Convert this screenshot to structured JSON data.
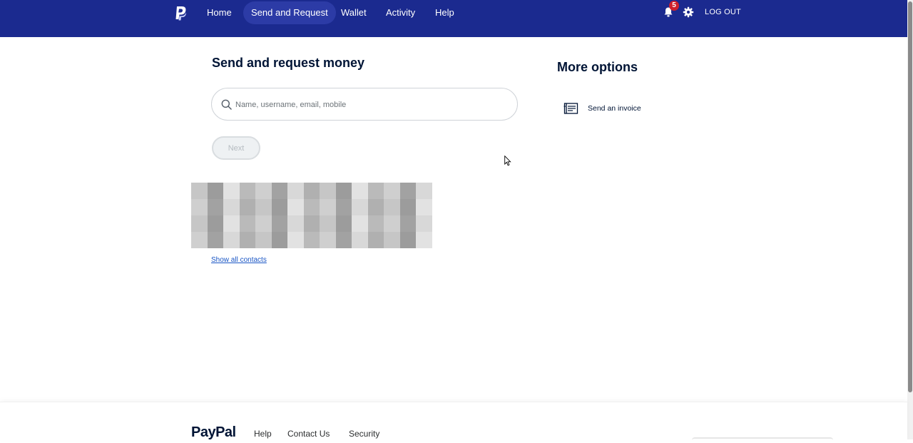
{
  "header": {
    "nav": [
      {
        "label": "Home"
      },
      {
        "label": "Send and Request"
      },
      {
        "label": "Wallet"
      },
      {
        "label": "Activity"
      },
      {
        "label": "Help"
      }
    ],
    "notification_count": "5",
    "logout_label": "LOG OUT"
  },
  "main": {
    "title": "Send and request money",
    "search_placeholder": "Name, username, email, mobile",
    "next_label": "Next",
    "show_all_label": "Show all contacts"
  },
  "more_options": {
    "title": "More options",
    "items": [
      {
        "label": "Send an invoice",
        "icon": "invoice-icon"
      }
    ]
  },
  "footer": {
    "logo": "PayPal",
    "links": [
      {
        "label": "Help"
      },
      {
        "label": "Contact Us"
      },
      {
        "label": "Security"
      }
    ]
  },
  "colors": {
    "header_bg": "#1b2a8f",
    "active_tab_bg": "#2c3ba6",
    "badge": "#d0202c",
    "link": "#1a56c5"
  }
}
